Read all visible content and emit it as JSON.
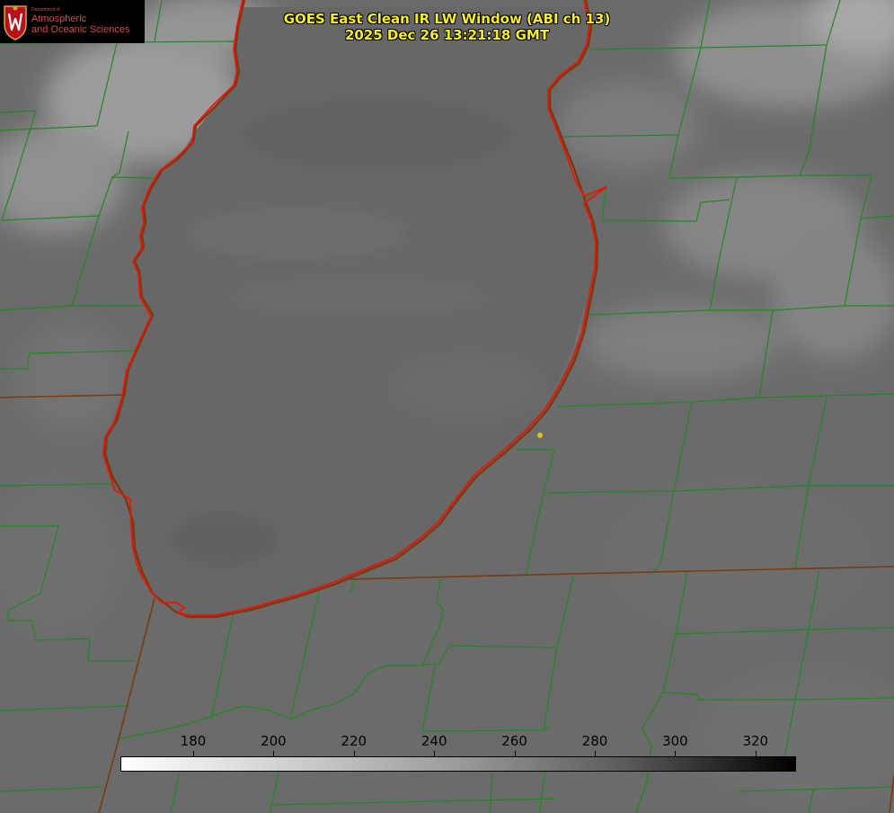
{
  "title_line1": "GOES East Clean IR LW Window (ABI ch 13)",
  "title_line2": "2025 Dec 26 13:21:18 GMT",
  "logo": {
    "dept_label": "Department of",
    "line1": "Atmospheric",
    "line2": "and Oceanic Sciences",
    "seal_icon": "uw-crest-icon"
  },
  "colorbar": {
    "tick_labels": [
      "180",
      "200",
      "220",
      "240",
      "260",
      "280",
      "300",
      "320"
    ],
    "min_color": "#ffffff",
    "max_color": "#000000"
  },
  "colors": {
    "title_text": "#f7ee22",
    "county_lines": "#1f8a1f",
    "shoreline_red": "#e8140a",
    "shoreline_dark": "#7a3a10",
    "station_dot": "#d6c81a"
  }
}
